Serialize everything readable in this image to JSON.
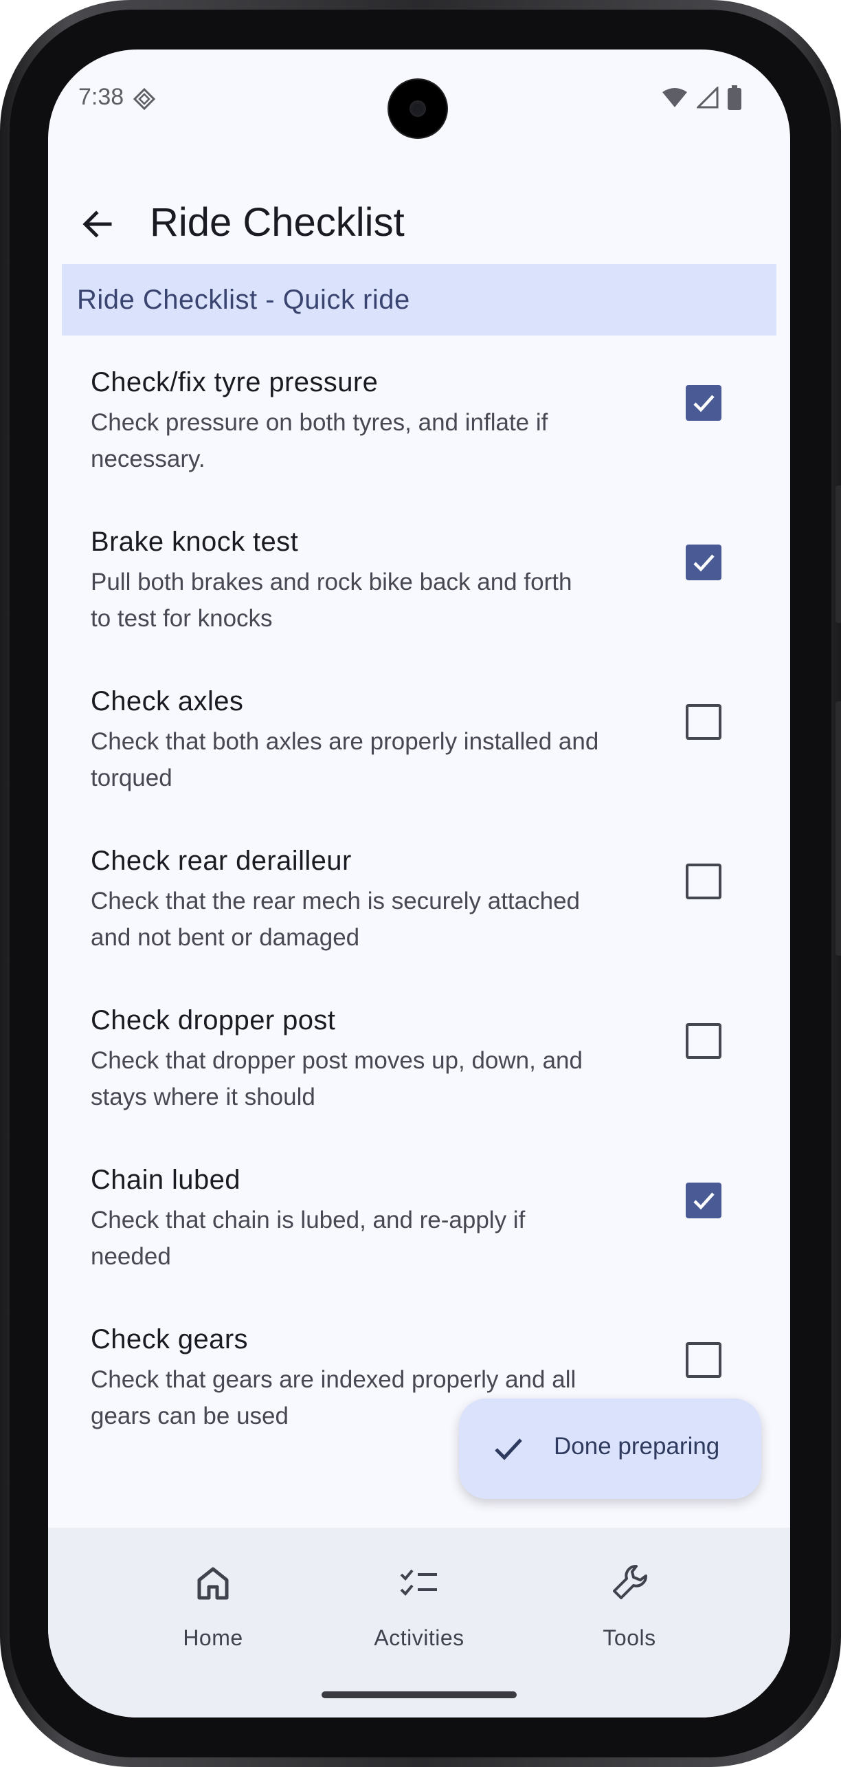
{
  "status_bar": {
    "time": "7:38"
  },
  "top_bar": {
    "title": "Ride Checklist"
  },
  "section": {
    "header": "Ride Checklist - Quick ride"
  },
  "checklist": [
    {
      "title": "Check/fix tyre pressure",
      "line1": "Check pressure on both tyres, and inflate if",
      "line2": "necessary.",
      "checked": true
    },
    {
      "title": "Brake knock test",
      "line1": "Pull both brakes and rock bike back and forth",
      "line2": "to test for knocks",
      "checked": true
    },
    {
      "title": "Check axles",
      "line1": "Check that both axles are properly installed and",
      "line2": "torqued",
      "checked": false
    },
    {
      "title": "Check rear derailleur",
      "line1": "Check that the rear mech is securely attached",
      "line2": "and not bent or damaged",
      "checked": false
    },
    {
      "title": "Check dropper post",
      "line1": "Check that dropper post moves up, down, and",
      "line2": "stays where it should",
      "checked": false
    },
    {
      "title": "Chain lubed",
      "line1": "Check that chain is lubed, and re-apply if",
      "line2": "needed",
      "checked": true
    },
    {
      "title": "Check gears",
      "line1": "Check that gears are indexed properly and all",
      "line2": "gears can be used",
      "checked": false
    }
  ],
  "fab": {
    "label": "Done preparing",
    "icon": "check-icon"
  },
  "bottom_nav": [
    {
      "label": "Home",
      "icon": "home-icon"
    },
    {
      "label": "Activities",
      "icon": "checklist-icon"
    },
    {
      "label": "Tools",
      "icon": "wrench-icon"
    }
  ],
  "colors": {
    "accent": "#4a5a95",
    "section_bg": "#dbe2fb",
    "screen_bg": "#f8f8ff",
    "nav_bg": "#eceef6"
  }
}
